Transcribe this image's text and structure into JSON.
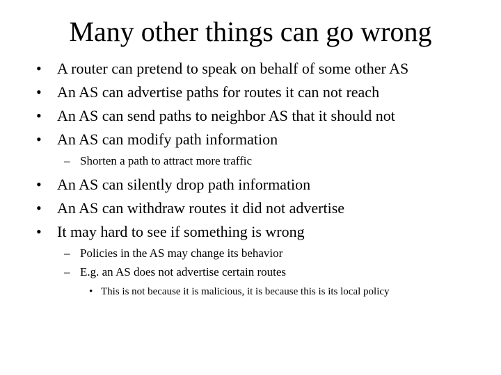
{
  "slide": {
    "title": "Many other things can go wrong",
    "bullets_top": [
      {
        "marker": "•",
        "text": "A router can pretend to speak on behalf of some other AS"
      },
      {
        "marker": "•",
        "text": "An AS can advertise paths for routes it can not reach"
      },
      {
        "marker": "•",
        "text": "An AS can send paths to neighbor AS that it should not"
      },
      {
        "marker": "•",
        "text": "An AS can modify path information"
      }
    ],
    "sub_modify": {
      "marker": "–",
      "text": "Shorten a path to attract more traffic"
    },
    "bullets_bottom": [
      {
        "marker": "•",
        "text": "An AS can silently drop path information"
      },
      {
        "marker": "•",
        "text": "An AS can withdraw routes it did not advertise"
      },
      {
        "marker": "•",
        "text": "It may hard to see if something is wrong"
      }
    ],
    "sub_wrong": [
      {
        "marker": "–",
        "text": "Policies in the AS may change its behavior"
      },
      {
        "marker": "–",
        "text": "E.g. an AS does not advertise certain routes"
      }
    ],
    "sub_sub": {
      "marker": "•",
      "text": "This is not because it is malicious, it is because this is its local policy"
    }
  }
}
